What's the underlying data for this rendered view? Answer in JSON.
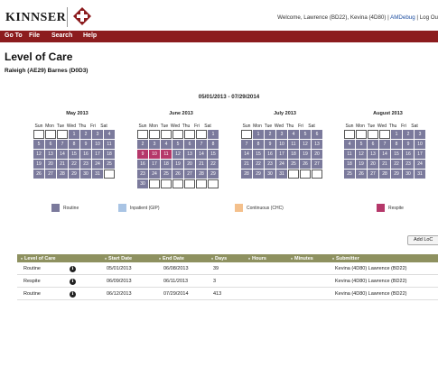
{
  "brand": {
    "name": "KINNSER",
    "accent": "#8c1c1e"
  },
  "header": {
    "welcome": "Welcome, Lawrence (BD22), Kevina (4D80) |",
    "amdebug": "AMDebug",
    "logout": "| Log Ou"
  },
  "menu": [
    "Go To",
    "File",
    "Search",
    "Help"
  ],
  "page": {
    "title": "Level of Care",
    "patient": "Raleigh (AE29) Barnes (D0D3)",
    "date_range": "05/01/2013 - 07/29/2014"
  },
  "calendar": {
    "weekdays": [
      "Sun",
      "Mon",
      "Tue",
      "Wed",
      "Thu",
      "Fri",
      "Sat"
    ],
    "months": [
      {
        "title": "May 2013",
        "lead": 3,
        "days": 31,
        "empty_until": 0,
        "respite": []
      },
      {
        "title": "June 2013",
        "lead": 6,
        "days": 30,
        "empty_until": 0,
        "respite": [
          9,
          10,
          11
        ]
      },
      {
        "title": "July 2013",
        "lead": 1,
        "days": 31,
        "empty_until": 0,
        "respite": []
      },
      {
        "title": "August 2013",
        "lead": 4,
        "days": 31,
        "empty_until": 0,
        "respite": []
      }
    ]
  },
  "legend": [
    {
      "label": "Routine",
      "color": "#7b7a9c"
    },
    {
      "label": "Inpatient (GIP)",
      "color": "#a9c4e4"
    },
    {
      "label": "Continuous (CHC)",
      "color": "#f4c08c"
    },
    {
      "label": "Respite",
      "color": "#b5386a"
    }
  ],
  "add_button": "Add LoC",
  "table": {
    "columns": [
      "Level of Care",
      "Start Date",
      "End Date",
      "Days",
      "Hours",
      "Minutes",
      "Submitter"
    ],
    "rows": [
      {
        "level": "Routine",
        "start": "05/01/2013",
        "end": "06/08/2013",
        "days": "39",
        "hours": "",
        "minutes": "",
        "submitter": "Kevina (4D80) Lawrence (BD22)"
      },
      {
        "level": "Respite",
        "start": "06/09/2013",
        "end": "06/11/2013",
        "days": "3",
        "hours": "",
        "minutes": "",
        "submitter": "Kevina (4D80) Lawrence (BD22)"
      },
      {
        "level": "Routine",
        "start": "06/12/2013",
        "end": "07/29/2014",
        "days": "413",
        "hours": "",
        "minutes": "",
        "submitter": "Kevina (4D80) Lawrence (BD22)"
      }
    ]
  }
}
